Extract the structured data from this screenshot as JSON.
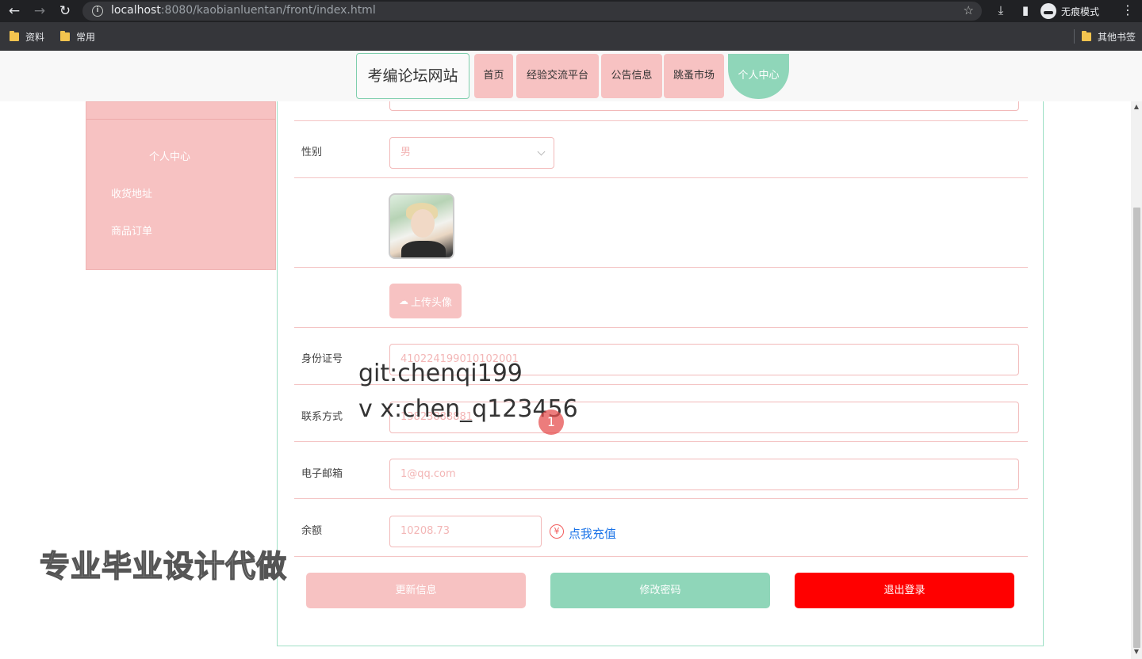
{
  "browser": {
    "url_host": "localhost",
    "url_rest": ":8080/kaobianluentan/front/index.html",
    "incognito_label": "无痕模式",
    "bookmarks": [
      "资料",
      "常用"
    ],
    "other_bookmarks": "其他书签"
  },
  "header": {
    "logo": "考编论坛网站",
    "nav": [
      "首页",
      "经验交流平台",
      "公告信息",
      "跳蚤市场",
      "个人中心"
    ],
    "active_nav": "个人中心"
  },
  "sidebar": {
    "title": "个人中心",
    "items": [
      "收货地址",
      "商品订单"
    ]
  },
  "form": {
    "gender_label": "性别",
    "gender_value": "男",
    "upload_label": "上传头像",
    "id_label": "身份证号",
    "id_value": "410224199010102001",
    "phone_label": "联系方式",
    "phone_value": "13823888881",
    "email_label": "电子邮箱",
    "email_value": "1@qq.com",
    "balance_label": "余额",
    "balance_value": "10208.73",
    "recharge_icon": "¥",
    "recharge_link": "点我充值"
  },
  "actions": {
    "update": "更新信息",
    "change_password": "修改密码",
    "logout": "退出登录"
  },
  "colors": {
    "pink": "#f7c2c2",
    "mint": "#8fd6b9",
    "danger": "#ff0000",
    "link": "#1a73e8"
  },
  "overlay": {
    "watermark_git": "git:chenqi199",
    "watermark_vx": "v x:chen_q123456",
    "cursor_badge": "1",
    "promo": "专业毕业设计代做"
  }
}
